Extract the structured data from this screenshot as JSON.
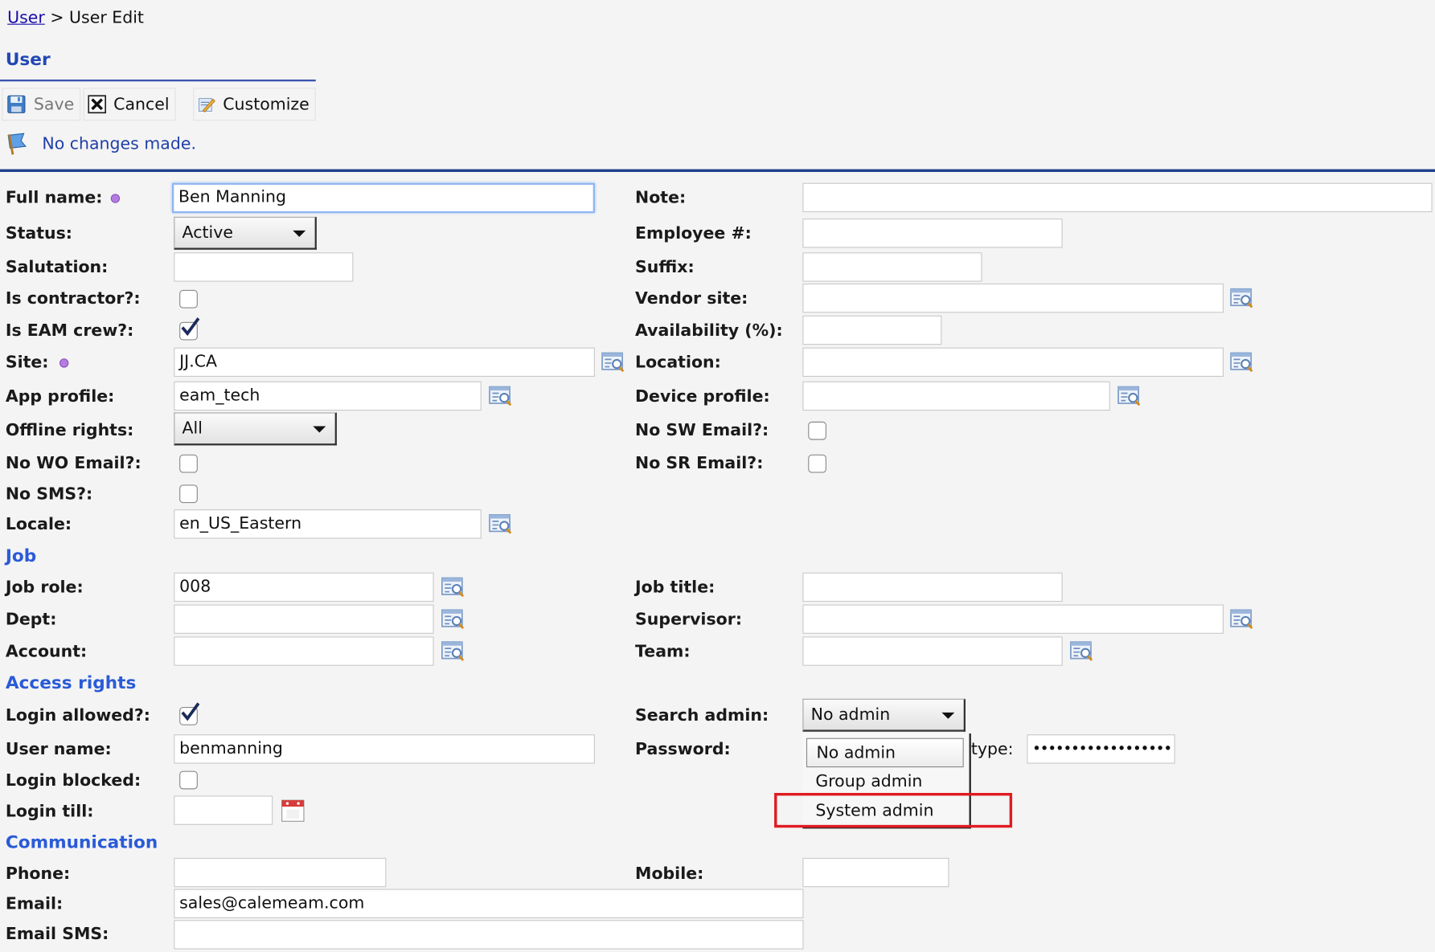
{
  "breadcrumb": {
    "link": "User",
    "separator": ">",
    "current": "User Edit"
  },
  "page_title": "User",
  "toolbar": {
    "save": "Save",
    "cancel": "Cancel",
    "customize": "Customize"
  },
  "message": "No changes made.",
  "fields": {
    "full_name": {
      "label": "Full name:",
      "value": "Ben Manning"
    },
    "status": {
      "label": "Status:",
      "value": "Active"
    },
    "salutation": {
      "label": "Salutation:",
      "value": ""
    },
    "is_contractor": {
      "label": "Is contractor?:",
      "checked": false
    },
    "is_eam_crew": {
      "label": "Is EAM crew?:",
      "checked": true
    },
    "site": {
      "label": "Site:",
      "value": "JJ.CA"
    },
    "app_profile": {
      "label": "App profile:",
      "value": "eam_tech"
    },
    "offline_rights": {
      "label": "Offline rights:",
      "value": "All"
    },
    "no_wo_email": {
      "label": "No WO Email?:",
      "checked": false
    },
    "no_sms": {
      "label": "No SMS?:",
      "checked": false
    },
    "locale": {
      "label": "Locale:",
      "value": "en_US_Eastern"
    },
    "note": {
      "label": "Note:",
      "value": ""
    },
    "employee_no": {
      "label": "Employee #:",
      "value": ""
    },
    "suffix": {
      "label": "Suffix:",
      "value": ""
    },
    "vendor_site": {
      "label": "Vendor site:",
      "value": ""
    },
    "availability": {
      "label": "Availability (%):",
      "value": ""
    },
    "location": {
      "label": "Location:",
      "value": ""
    },
    "device_profile": {
      "label": "Device profile:",
      "value": ""
    },
    "no_sw_email": {
      "label": "No SW Email?:",
      "checked": false
    },
    "no_sr_email": {
      "label": "No SR Email?:",
      "checked": false
    },
    "job_role": {
      "label": "Job role:",
      "value": "008"
    },
    "dept": {
      "label": "Dept:",
      "value": ""
    },
    "account": {
      "label": "Account:",
      "value": ""
    },
    "job_title": {
      "label": "Job title:",
      "value": ""
    },
    "supervisor": {
      "label": "Supervisor:",
      "value": ""
    },
    "team": {
      "label": "Team:",
      "value": ""
    },
    "login_allowed": {
      "label": "Login allowed?:",
      "checked": true
    },
    "user_name": {
      "label": "User name:",
      "value": "benmanning"
    },
    "login_blocked": {
      "label": "Login blocked:",
      "checked": false
    },
    "login_till": {
      "label": "Login till:",
      "value": ""
    },
    "search_admin": {
      "label": "Search admin:",
      "value": "No admin",
      "options": [
        "No admin",
        "Group admin",
        "System admin"
      ]
    },
    "password": {
      "label": "Password:",
      "retype_label": "type:",
      "value": "••••••••••••••••••"
    },
    "phone": {
      "label": "Phone:",
      "value": ""
    },
    "mobile": {
      "label": "Mobile:",
      "value": ""
    },
    "email": {
      "label": "Email:",
      "value": "sales@calemeam.com"
    },
    "email_sms": {
      "label": "Email SMS:",
      "value": ""
    }
  },
  "sections": {
    "job": "Job",
    "access_rights": "Access rights",
    "communication": "Communication"
  },
  "colors": {
    "section": "#2a5bd7",
    "title": "#2348b4",
    "highlight": "#e01b22",
    "required_dot": "#b57ce0"
  }
}
